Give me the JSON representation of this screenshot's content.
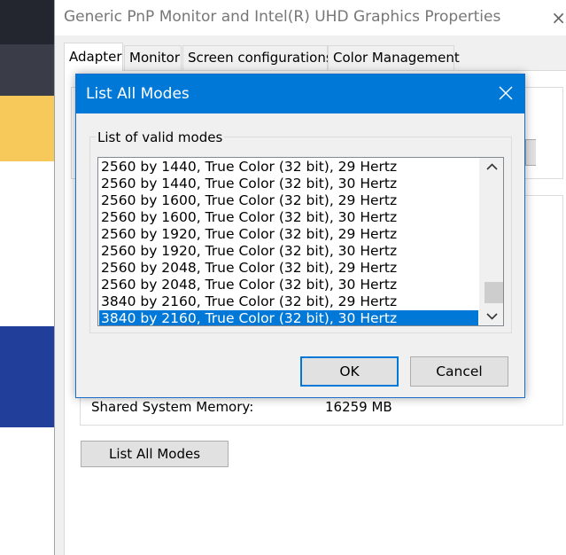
{
  "window": {
    "title": "Generic PnP Monitor and Intel(R) UHD Graphics Properties",
    "close_glyph": "×"
  },
  "tabs": [
    {
      "label": "Adapter",
      "active": true
    },
    {
      "label": "Monitor",
      "active": false
    },
    {
      "label": "Screen configurations",
      "active": false
    },
    {
      "label": "Color Management",
      "active": false
    }
  ],
  "adapter": {
    "shared_memory_label": "Shared System Memory:",
    "shared_memory_value": "16259 MB",
    "list_all_modes_label": "List All Modes"
  },
  "dialog": {
    "title": "List All Modes",
    "close_icon": "close-icon",
    "group_label": "List of valid modes",
    "modes": [
      "2560 by 1440, True Color (32 bit), 29 Hertz",
      "2560 by 1440, True Color (32 bit), 30 Hertz",
      "2560 by 1600, True Color (32 bit), 29 Hertz",
      "2560 by 1600, True Color (32 bit), 30 Hertz",
      "2560 by 1920, True Color (32 bit), 29 Hertz",
      "2560 by 1920, True Color (32 bit), 30 Hertz",
      "2560 by 2048, True Color (32 bit), 29 Hertz",
      "2560 by 2048, True Color (32 bit), 30 Hertz",
      "3840 by 2160, True Color (32 bit), 29 Hertz",
      "3840 by 2160, True Color (32 bit), 30 Hertz"
    ],
    "selected_index": 9,
    "ok_label": "OK",
    "cancel_label": "Cancel"
  },
  "colors": {
    "accent": "#0078d7",
    "selection_text": "#ffffff"
  }
}
